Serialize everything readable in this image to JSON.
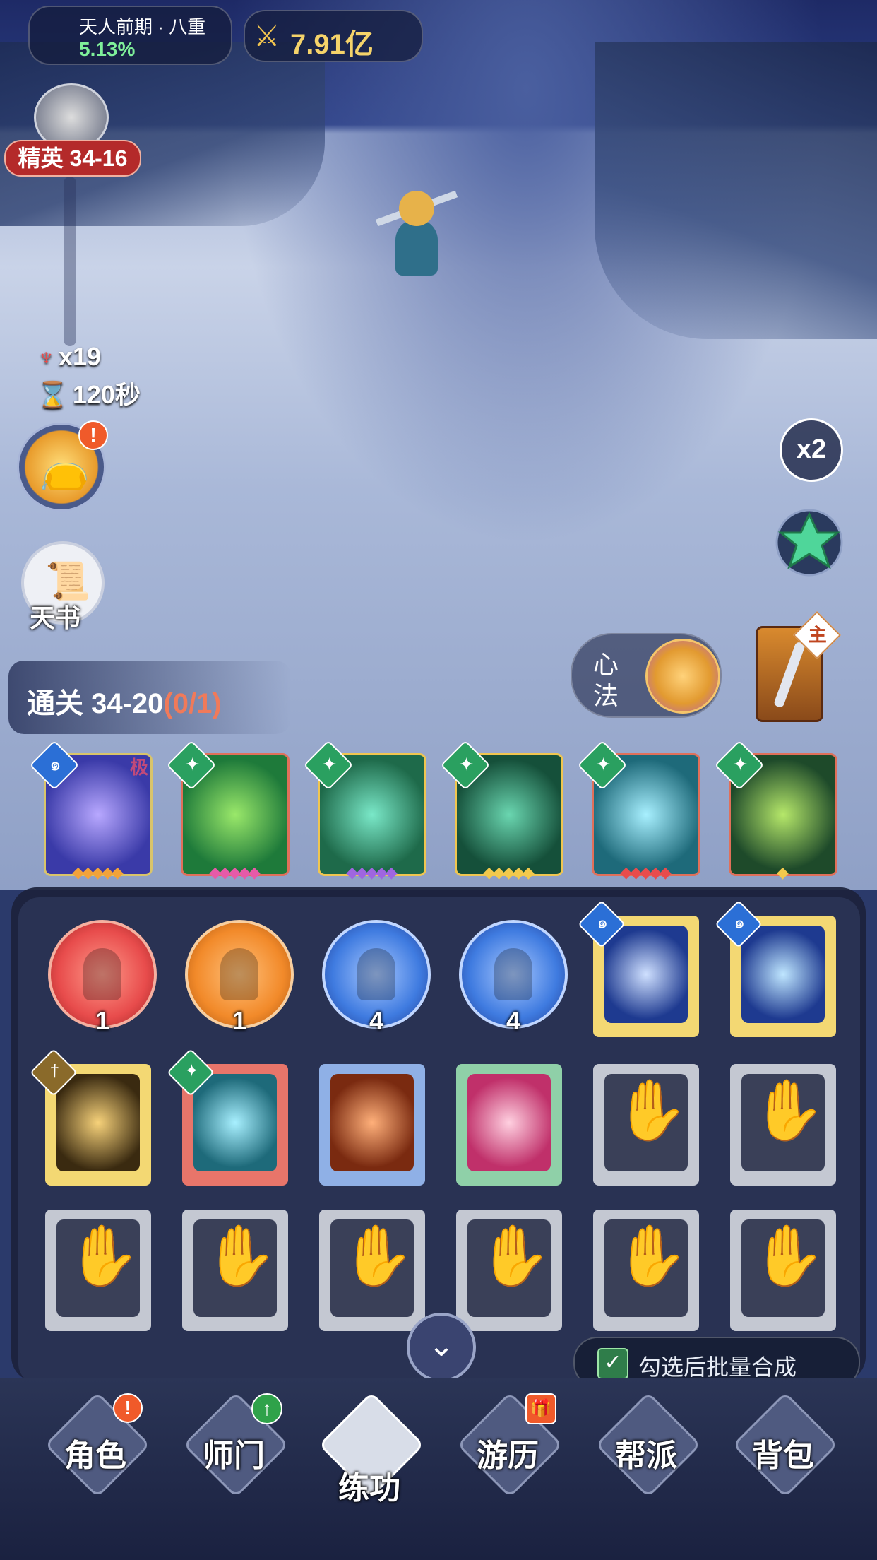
{
  "hud": {
    "realm_name": "天人前期 · 八重",
    "realm_progress": "5.13%",
    "power_value": "7.91亿",
    "stage": "精英 34-16",
    "enemies_left": "x19",
    "time_left": "120秒"
  },
  "left_buttons": {
    "book_label": "天书"
  },
  "right_buttons": {
    "speed_label": "x2"
  },
  "progress": {
    "label": "通关 34-20",
    "count": "(0/1)"
  },
  "xinfa": {
    "label_top": "心",
    "label_bottom": "法"
  },
  "weapon": {
    "tag": "主"
  },
  "equipped_skills": [
    {
      "grade": "极",
      "gem_color": "#2b6fd6",
      "border": "#d9c46a",
      "star_color": "#f2a23a"
    },
    {
      "grade": "",
      "gem_color": "#2aa060",
      "border": "#e0705a",
      "star_color": "#e65aa8"
    },
    {
      "grade": "",
      "gem_color": "#2aa060",
      "border": "#f0c650",
      "star_color": "#9f66e0"
    },
    {
      "grade": "",
      "gem_color": "#2aa060",
      "border": "#f0c650",
      "star_color": "#f2c94c"
    },
    {
      "grade": "",
      "gem_color": "#2aa060",
      "border": "#e0705a",
      "star_color": "#e84c4c"
    },
    {
      "grade": "",
      "gem_color": "#2aa060",
      "border": "#e0705a",
      "star_color": "#f2c94c"
    }
  ],
  "inventory_orbs": [
    {
      "count": "1",
      "color": "#e84c4c"
    },
    {
      "count": "1",
      "color": "#f28a2a"
    },
    {
      "count": "4",
      "color": "#3f7be0"
    },
    {
      "count": "4",
      "color": "#3f7be0"
    }
  ],
  "merge": {
    "label": "勾选后批量合成"
  },
  "nav": [
    {
      "label": "角色",
      "badge": "!"
    },
    {
      "label": "师门",
      "badge": "↑"
    },
    {
      "label": "练功",
      "badge": ""
    },
    {
      "label": "游历",
      "badge": "🎁"
    },
    {
      "label": "帮派",
      "badge": ""
    },
    {
      "label": "背包",
      "badge": ""
    }
  ],
  "colors": {
    "accent": "#f5d36a",
    "alert": "#f05a2a",
    "progress_green": "#7ff09a",
    "stage_red": "#b42a2a"
  }
}
